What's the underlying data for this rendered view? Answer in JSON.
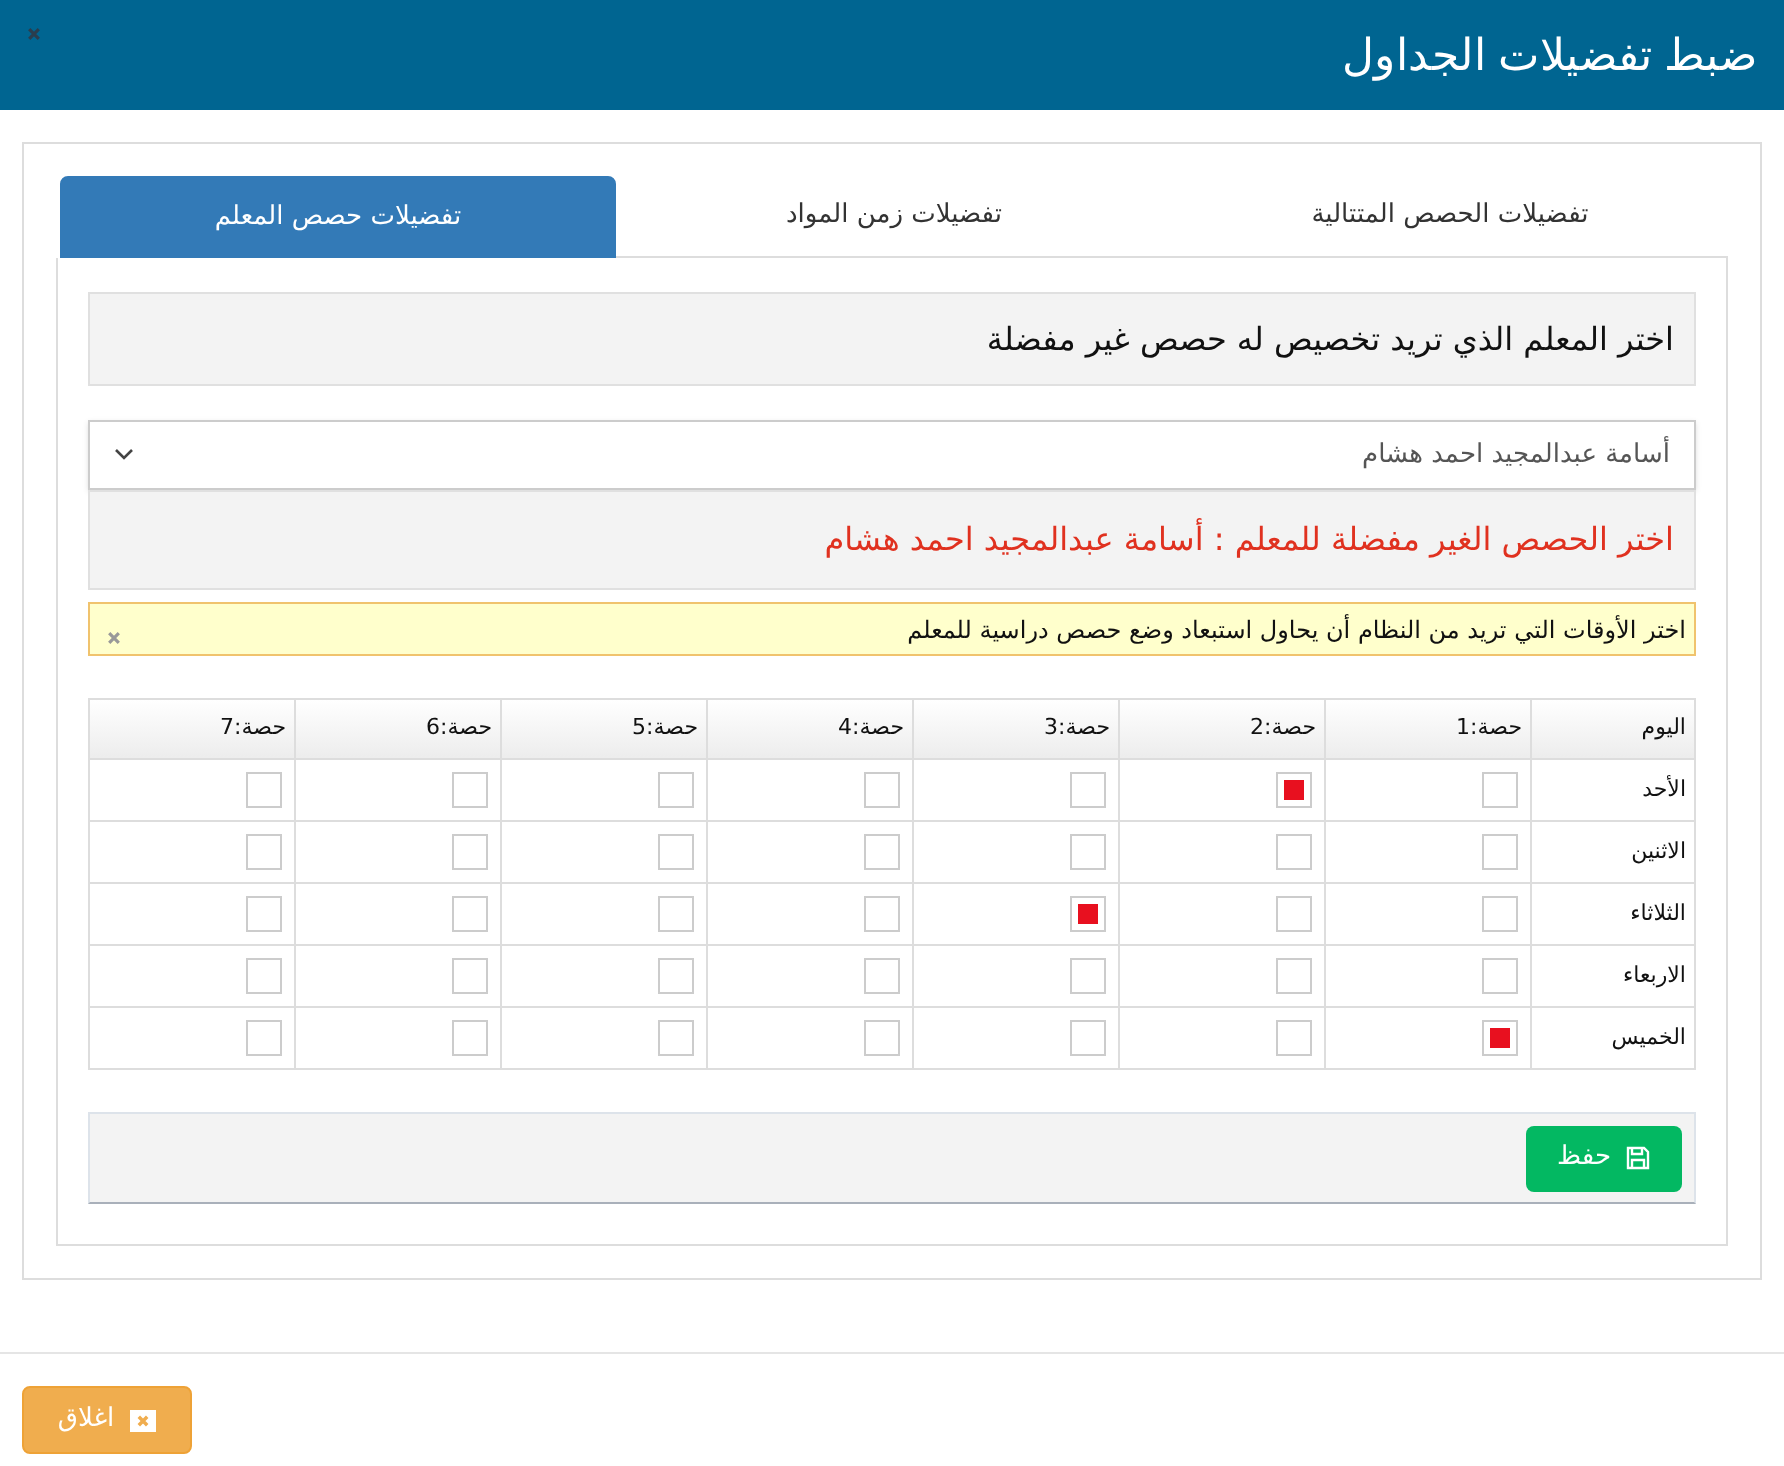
{
  "dialog": {
    "title": "ضبط تفضيلات الجداول"
  },
  "tabs": [
    {
      "label": "تفضيلات الحصص المتتالية",
      "selected": false
    },
    {
      "label": "تفضيلات زمن المواد",
      "selected": false
    },
    {
      "label": "تفضيلات حصص المعلم",
      "selected": true
    }
  ],
  "teacher_prompt": "اختر المعلم الذي تريد تخصيص له حصص غير مفضلة",
  "teacher_select": {
    "value": "أسامة عبدالمجيد احمد هشام"
  },
  "periods_heading": "اختر الحصص الغير مفضلة للمعلم : أسامة عبدالمجيد احمد هشام",
  "alert": {
    "text": "اختر الأوقات التي تريد من النظام أن يحاول استبعاد وضع حصص دراسية للمعلم"
  },
  "table": {
    "columns": [
      "اليوم",
      "حصة:1",
      "حصة:2",
      "حصة:3",
      "حصة:4",
      "حصة:5",
      "حصة:6",
      "حصة:7"
    ],
    "rows": [
      {
        "day": "الأحد",
        "cells": [
          {
            "checked": false
          },
          {
            "checked": true
          },
          {
            "checked": false
          },
          {
            "checked": false
          },
          {
            "checked": false
          },
          {
            "checked": false
          },
          {
            "checked": false
          }
        ]
      },
      {
        "day": "الاثنين",
        "cells": [
          {
            "checked": false
          },
          {
            "checked": false
          },
          {
            "checked": false
          },
          {
            "checked": false
          },
          {
            "checked": false
          },
          {
            "checked": false
          },
          {
            "checked": false
          }
        ]
      },
      {
        "day": "الثلاثاء",
        "cells": [
          {
            "checked": false
          },
          {
            "checked": false
          },
          {
            "checked": true
          },
          {
            "checked": false
          },
          {
            "checked": false
          },
          {
            "checked": false
          },
          {
            "checked": false
          }
        ]
      },
      {
        "day": "الاربعاء",
        "cells": [
          {
            "checked": false
          },
          {
            "checked": false
          },
          {
            "checked": false
          },
          {
            "checked": false
          },
          {
            "checked": false
          },
          {
            "checked": false
          },
          {
            "checked": false
          }
        ]
      },
      {
        "day": "الخميس",
        "cells": [
          {
            "checked": true
          },
          {
            "checked": false
          },
          {
            "checked": false
          },
          {
            "checked": false
          },
          {
            "checked": false
          },
          {
            "checked": false
          },
          {
            "checked": false
          }
        ]
      }
    ]
  },
  "save_button": "حفظ",
  "close_button": "اغلاق"
}
